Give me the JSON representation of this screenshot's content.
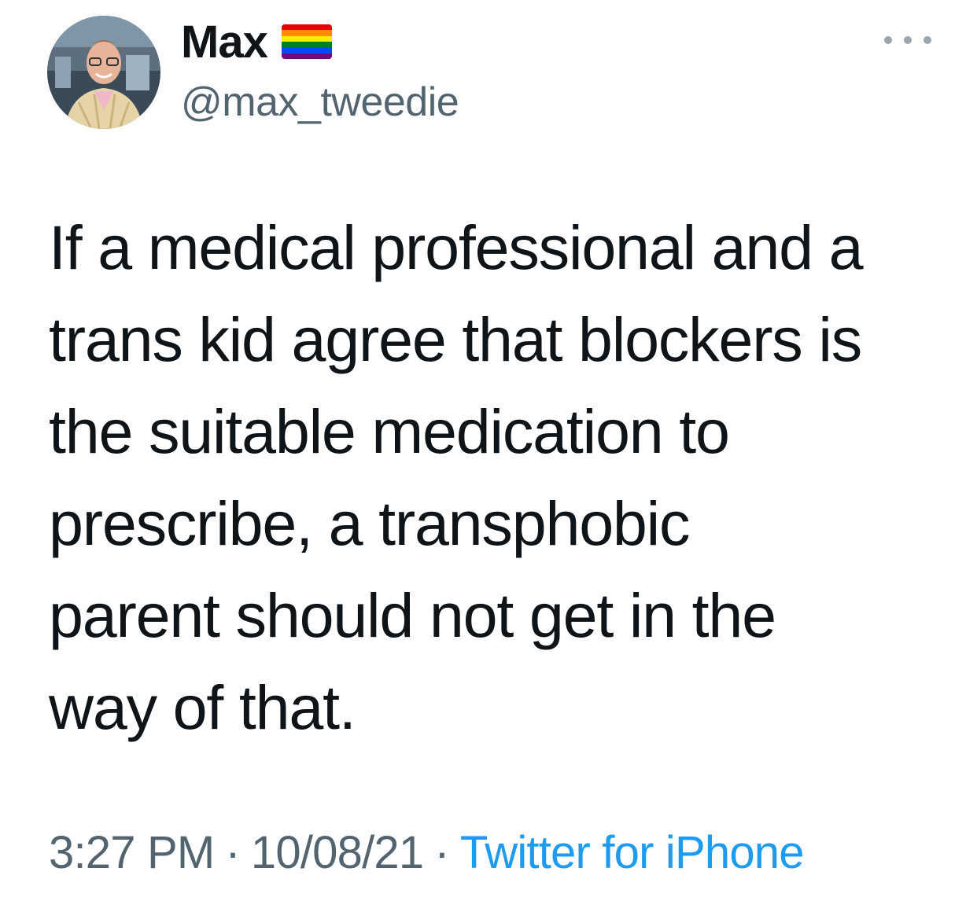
{
  "author": {
    "display_name": "Max",
    "handle": "@max_tweedie",
    "avatar_icon": "profile-photo",
    "badge_icon": "rainbow-flag-icon"
  },
  "menu": {
    "more_icon": "more-dots-icon"
  },
  "tweet": {
    "text_lines": [
      "If a medical professional and a",
      "trans kid agree that blockers is",
      "the suitable medication to",
      "prescribe, a transphobic",
      "parent should not get in the",
      "way of that."
    ]
  },
  "meta": {
    "time": "3:27 PM",
    "separator": "·",
    "date": "10/08/21",
    "source": "Twitter for iPhone"
  },
  "colors": {
    "text": "#0f1419",
    "secondary": "#536471",
    "link": "#1d9bf0",
    "flag": [
      "#e40303",
      "#ff8c00",
      "#ffed00",
      "#008026",
      "#004dff",
      "#750787"
    ]
  }
}
